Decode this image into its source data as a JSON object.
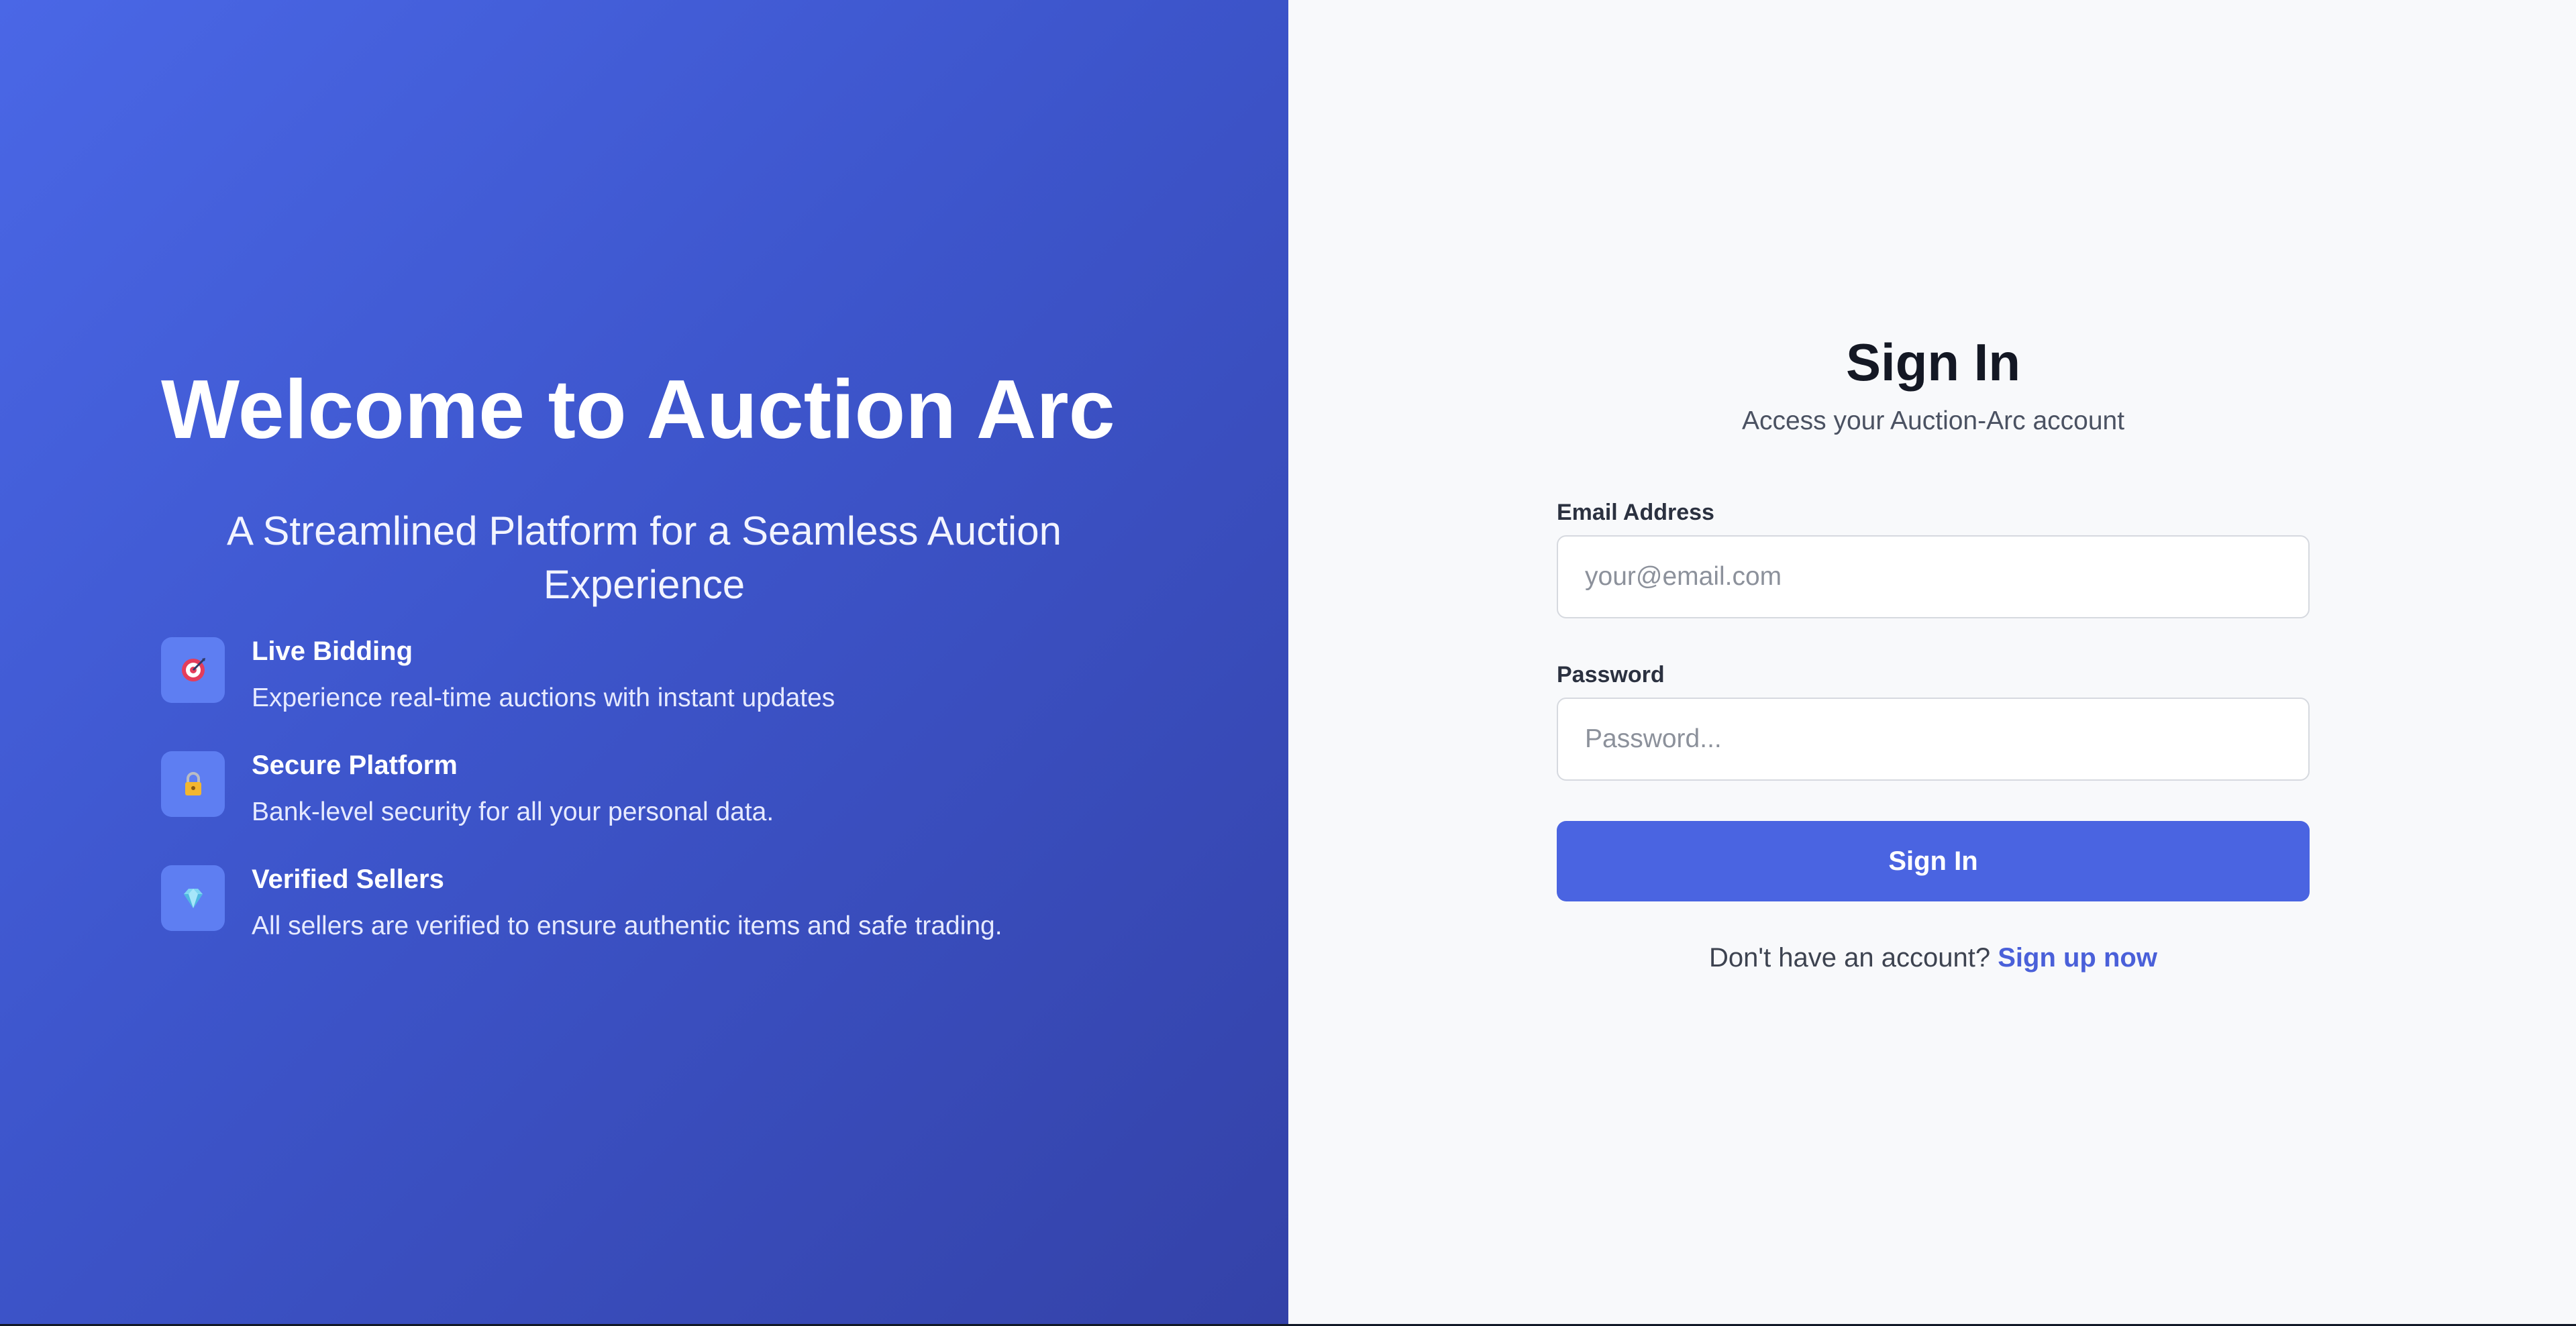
{
  "hero": {
    "title": "Welcome to Auction Arc",
    "subtitle": "A Streamlined Platform for a Seamless Auction Experience",
    "features": [
      {
        "icon": "target-icon",
        "title": "Live Bidding",
        "description": "Experience real-time auctions with instant updates"
      },
      {
        "icon": "lock-icon",
        "title": "Secure Platform",
        "description": "Bank-level security for all your personal data."
      },
      {
        "icon": "gem-icon",
        "title": "Verified Sellers",
        "description": "All sellers are verified to ensure authentic items and safe trading."
      }
    ]
  },
  "signin": {
    "title": "Sign In",
    "subtitle": "Access your Auction-Arc account",
    "email_label": "Email Address",
    "email_placeholder": "your@email.com",
    "email_value": "",
    "password_label": "Password",
    "password_placeholder": "Password...",
    "password_value": "",
    "submit_label": "Sign In",
    "signup_prompt": "Don't have an account?",
    "signup_link": "Sign up now"
  },
  "colors": {
    "hero_gradient_start": "#4a67e6",
    "hero_gradient_end": "#3442a8",
    "primary_button": "#4a64e1",
    "link": "#4a60d9",
    "form_background": "#f8f9fb"
  }
}
